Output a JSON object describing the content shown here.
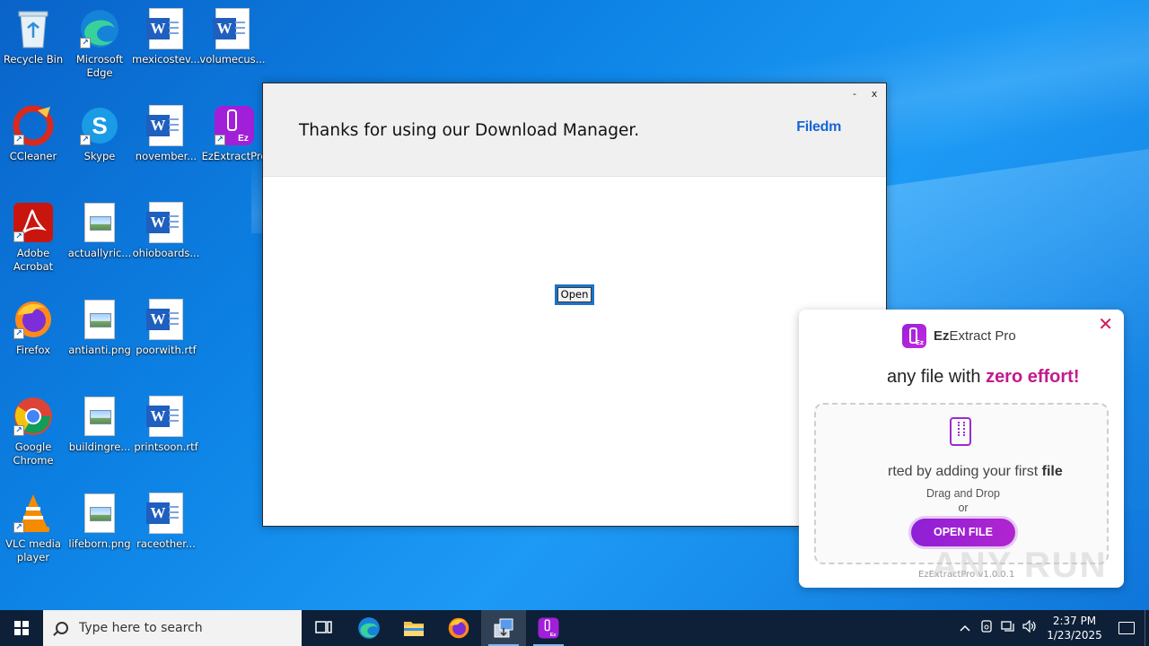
{
  "desktop": {
    "icons": [
      {
        "label": "Recycle Bin",
        "icon": "recycle-bin-icon"
      },
      {
        "label": "Microsoft Edge",
        "icon": "edge-icon"
      },
      {
        "label": "mexicostev...",
        "icon": "word-doc-icon"
      },
      {
        "label": "volumecus...",
        "icon": "word-doc-icon"
      },
      {
        "label": "CCleaner",
        "icon": "ccleaner-icon"
      },
      {
        "label": "Skype",
        "icon": "skype-icon"
      },
      {
        "label": "november...",
        "icon": "word-doc-icon"
      },
      {
        "label": "EzExtractPro",
        "icon": "ezextract-icon"
      },
      {
        "label": "Adobe Acrobat",
        "icon": "acrobat-icon"
      },
      {
        "label": "actuallyric...",
        "icon": "png-file-icon"
      },
      {
        "label": "ohioboards...",
        "icon": "word-doc-icon"
      },
      {
        "label": "Firefox",
        "icon": "firefox-icon"
      },
      {
        "label": "antianti.png",
        "icon": "png-file-icon"
      },
      {
        "label": "poorwith.rtf",
        "icon": "word-doc-icon"
      },
      {
        "label": "Google Chrome",
        "icon": "chrome-icon"
      },
      {
        "label": "buildingre...",
        "icon": "png-file-icon"
      },
      {
        "label": "printsoon.rtf",
        "icon": "word-doc-icon"
      },
      {
        "label": "VLC media player",
        "icon": "vlc-icon"
      },
      {
        "label": "lifeborn.png",
        "icon": "png-file-icon"
      },
      {
        "label": "raceother...",
        "icon": "word-doc-icon"
      }
    ]
  },
  "filedm": {
    "title": "Thanks for using our Download Manager.",
    "logo": "Filedm",
    "minimize": "-",
    "close": "x",
    "open_button": "Open"
  },
  "ezextract": {
    "brand_bold": "Ez",
    "brand_rest": "Extract Pro",
    "logo_text": "Ez",
    "close": "✕",
    "tagline_pre": "any file with ",
    "tagline_bold": "zero effort!",
    "start_pre": "rted by adding your first ",
    "start_bold": "file",
    "drag_drop": "Drag and Drop",
    "or": "or",
    "open_file": "OPEN FILE",
    "version": "EzExtractPro v1.0.0.1"
  },
  "watermark": "ANY RUN",
  "taskbar": {
    "search_placeholder": "Type here to search",
    "time": "2:37 PM",
    "date": "1/23/2025",
    "accent": "#0d2038"
  }
}
